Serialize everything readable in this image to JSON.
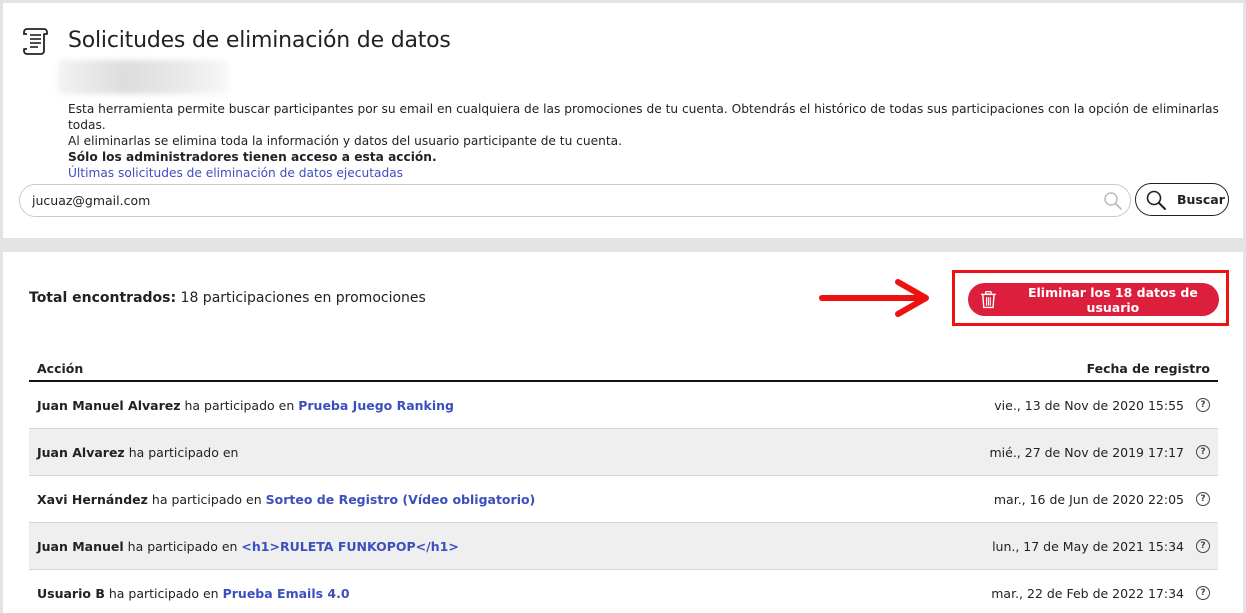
{
  "page": {
    "title": "Solicitudes de eliminación de datos",
    "description_line1": "Esta herramienta permite buscar participantes por su email en cualquiera de las promociones de tu cuenta. Obtendrás el histórico de todas sus participaciones con la opción de eliminarlas todas.",
    "description_line2": "Al eliminarlas se elimina toda la información y datos del usuario participante de tu cuenta.",
    "admin_note": "Sólo los administradores tienen acceso a esta acción.",
    "history_link": "Últimas solicitudes de eliminación de datos ejecutadas"
  },
  "search": {
    "value": "jucuaz@gmail.com",
    "button_label": "Buscar"
  },
  "results": {
    "total_label": "Total encontrados:",
    "total_text": "18 participaciones en promociones",
    "delete_button_label": "Eliminar los 18 datos de usuario"
  },
  "table": {
    "col_action": "Acción",
    "col_date": "Fecha de registro",
    "rows": [
      {
        "name": "Juan Manuel Alvarez",
        "verb": "ha participado en",
        "promo": "Prueba Juego Ranking",
        "date": "vie., 13 de Nov de 2020 15:55"
      },
      {
        "name": "Juan Alvarez",
        "verb": "ha participado en",
        "promo": "",
        "date": "mié., 27 de Nov de 2019 17:17"
      },
      {
        "name": "Xavi Hernández",
        "verb": "ha participado en",
        "promo": "Sorteo de Registro (Vídeo obligatorio)",
        "date": "mar., 16 de Jun de 2020 22:05"
      },
      {
        "name": "Juan Manuel",
        "verb": "ha participado en",
        "promo": "<h1>RULETA FUNKOPOP</h1>",
        "date": "lun., 17 de May de 2021 15:34"
      },
      {
        "name": "Usuario B",
        "verb": "ha participado en",
        "promo": "Prueba Emails 4.0",
        "date": "mar., 22 de Feb de 2022 17:34"
      }
    ],
    "help_glyph": "?"
  },
  "icons": {
    "header": "document-list-icon",
    "search": "magnifier-icon",
    "delete": "trash-icon",
    "help": "question-circle-icon"
  },
  "colors": {
    "accent_link": "#3c4fbf",
    "danger": "#dd1f3e",
    "highlight": "#ee1111"
  }
}
